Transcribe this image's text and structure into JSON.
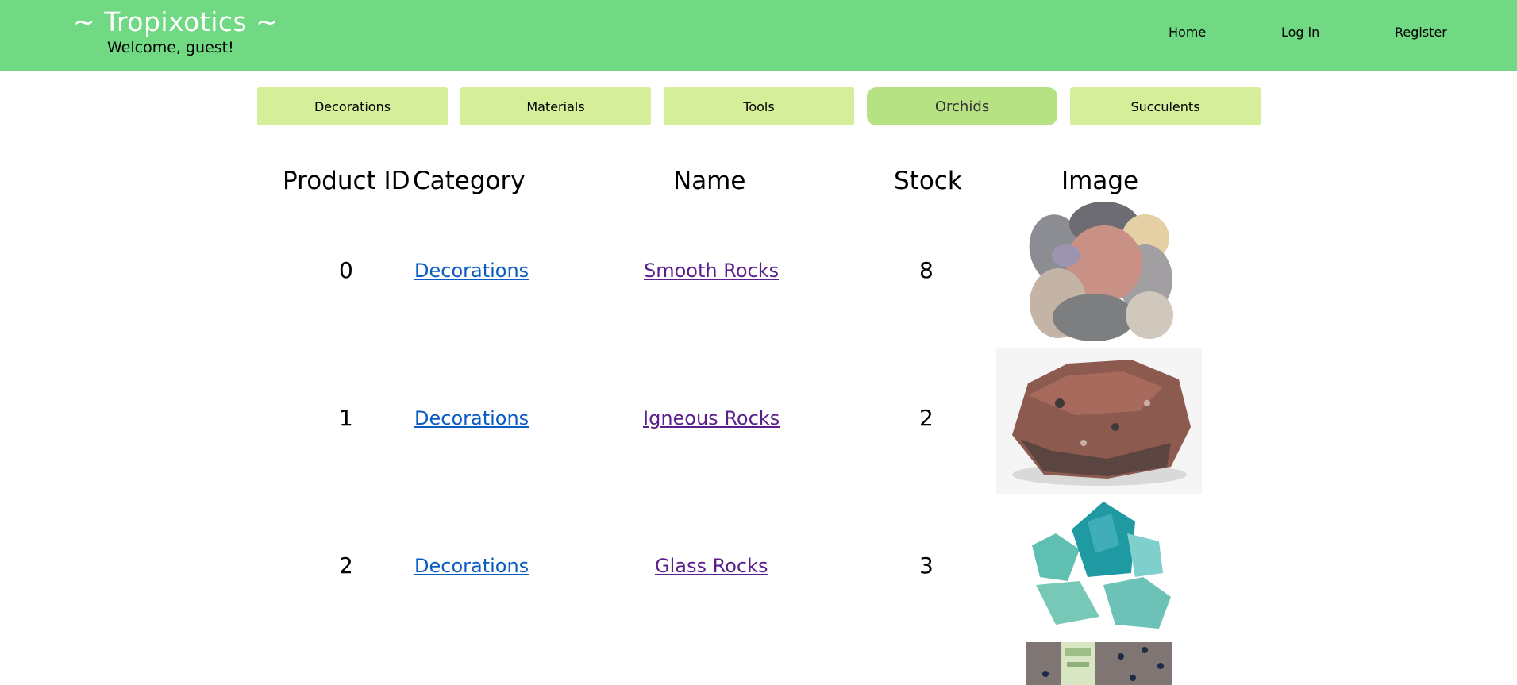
{
  "header": {
    "brand": "~ Tropixotics ~",
    "welcome": "Welcome, guest!",
    "nav": {
      "home": "Home",
      "login": "Log in",
      "register": "Register"
    }
  },
  "categories": [
    "Decorations",
    "Materials",
    "Tools",
    "Orchids",
    "Succulents"
  ],
  "active_category": "Orchids",
  "table": {
    "headers": {
      "id": "Product ID",
      "category": "Category",
      "name": "Name",
      "stock": "Stock",
      "image": "Image"
    },
    "rows": [
      {
        "id": "0",
        "category": "Decorations",
        "name": "Smooth Rocks",
        "stock": "8",
        "image": "pile of smooth rocks"
      },
      {
        "id": "1",
        "category": "Decorations",
        "name": "Igneous Rocks",
        "stock": "2",
        "image": "igneous rock"
      },
      {
        "id": "2",
        "category": "Decorations",
        "name": "Glass Rocks",
        "stock": "3",
        "image": "glass rocks"
      },
      {
        "id": "",
        "category": "",
        "name": "",
        "stock": "",
        "image": "product image"
      }
    ]
  },
  "colors": {
    "header_bg": "#71d883",
    "category_bg": "#d5ee99",
    "category_active_bg": "#b7e284",
    "link_category": "#0a5cc2",
    "link_name_visited": "#5a1f8a"
  }
}
